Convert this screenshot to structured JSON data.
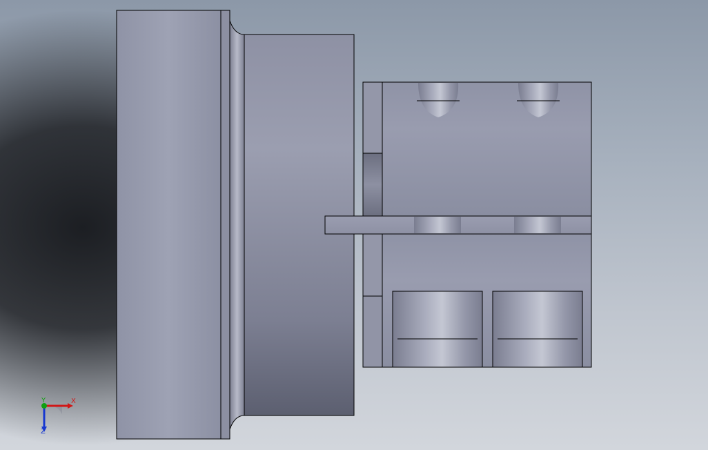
{
  "viewport": {
    "background_top": "#8c98a8",
    "background_bottom": "#d2d6dc",
    "vignette": "#1c1e22"
  },
  "model": {
    "part_color": "#9a9cb0",
    "edge_color": "#000000"
  },
  "triad": {
    "x_label": "X",
    "y_label": "Y",
    "z_label": "Z",
    "x_color": "#d01818",
    "y_color": "#10a010",
    "z_color": "#1838d0"
  }
}
